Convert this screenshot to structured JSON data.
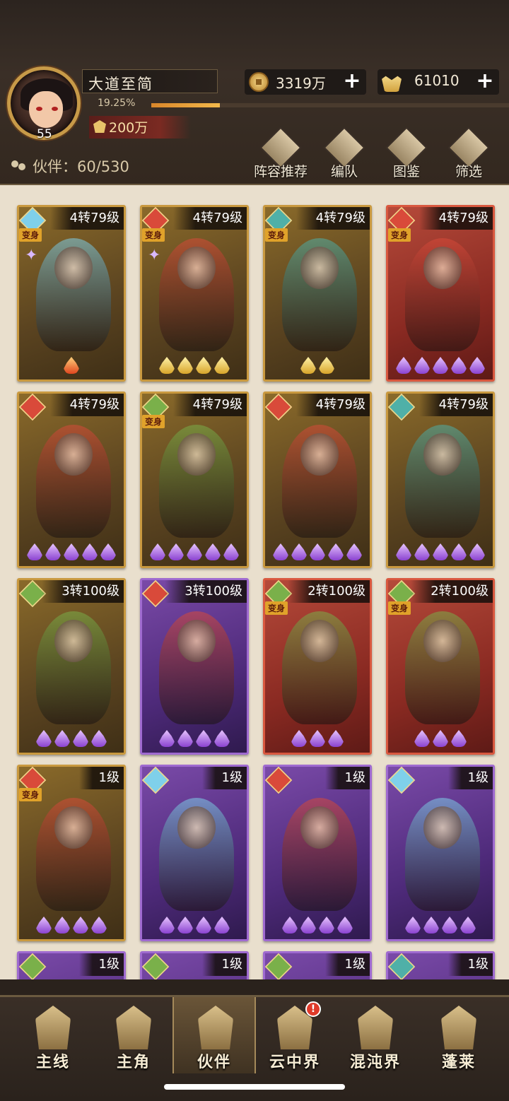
{
  "player": {
    "name": "大道至简",
    "level": "55",
    "exp_percent": "19.25%",
    "exp_fraction": 0.1925,
    "power": "200万"
  },
  "resources": {
    "coins": "3319万",
    "ingots": "61010"
  },
  "partner_count": "伙伴：60/530",
  "toolbar": [
    "阵容推荐",
    "编队",
    "图鉴",
    "筛选"
  ],
  "cards": [
    {
      "level": "4转79级",
      "frame": "gold",
      "element": "ice",
      "bian": true,
      "stars": 1,
      "star_color": "red",
      "sparkle": true
    },
    {
      "level": "4转79级",
      "frame": "gold",
      "element": "fire",
      "bian": true,
      "stars": 4,
      "star_color": "gold",
      "sparkle": true
    },
    {
      "level": "4转79级",
      "frame": "gold",
      "element": "ghost",
      "bian": true,
      "stars": 2,
      "star_color": "gold",
      "sparkle": false
    },
    {
      "level": "4转79级",
      "frame": "red",
      "element": "fire",
      "bian": true,
      "stars": 5,
      "star_color": "purple",
      "sparkle": false
    },
    {
      "level": "4转79级",
      "frame": "gold",
      "element": "fire",
      "bian": false,
      "stars": 5,
      "star_color": "purple",
      "sparkle": false
    },
    {
      "level": "4转79级",
      "frame": "gold",
      "element": "wind",
      "bian": true,
      "stars": 5,
      "star_color": "purple",
      "sparkle": false
    },
    {
      "level": "4转79级",
      "frame": "gold",
      "element": "fire",
      "bian": false,
      "stars": 5,
      "star_color": "purple",
      "sparkle": false
    },
    {
      "level": "4转79级",
      "frame": "gold",
      "element": "ghost",
      "bian": false,
      "stars": 5,
      "star_color": "purple",
      "sparkle": false
    },
    {
      "level": "3转100级",
      "frame": "gold",
      "element": "wind",
      "bian": false,
      "stars": 4,
      "star_color": "purple",
      "sparkle": false
    },
    {
      "level": "3转100级",
      "frame": "purple",
      "element": "fire",
      "bian": false,
      "stars": 4,
      "star_color": "purple",
      "sparkle": false
    },
    {
      "level": "2转100级",
      "frame": "red",
      "element": "wind",
      "bian": true,
      "stars": 3,
      "star_color": "purple",
      "sparkle": false
    },
    {
      "level": "2转100级",
      "frame": "red",
      "element": "wind",
      "bian": true,
      "stars": 3,
      "star_color": "purple",
      "sparkle": false
    },
    {
      "level": "1级",
      "frame": "gold",
      "element": "fire",
      "bian": true,
      "stars": 4,
      "star_color": "purple",
      "sparkle": false
    },
    {
      "level": "1级",
      "frame": "purple",
      "element": "ice",
      "bian": false,
      "stars": 4,
      "star_color": "purple",
      "sparkle": false
    },
    {
      "level": "1级",
      "frame": "purple",
      "element": "fire",
      "bian": false,
      "stars": 4,
      "star_color": "purple",
      "sparkle": false
    },
    {
      "level": "1级",
      "frame": "purple",
      "element": "ice",
      "bian": false,
      "stars": 4,
      "star_color": "purple",
      "sparkle": false
    },
    {
      "level": "1级",
      "frame": "purple",
      "element": "wind",
      "bian": false,
      "stars": 0,
      "star_color": "purple",
      "sparkle": false
    },
    {
      "level": "1级",
      "frame": "purple",
      "element": "wind",
      "bian": false,
      "stars": 0,
      "star_color": "purple",
      "sparkle": false
    },
    {
      "level": "1级",
      "frame": "purple",
      "element": "wind",
      "bian": false,
      "stars": 0,
      "star_color": "purple",
      "sparkle": false
    },
    {
      "level": "1级",
      "frame": "purple",
      "element": "ghost",
      "bian": false,
      "stars": 0,
      "star_color": "purple",
      "sparkle": false
    }
  ],
  "bian_label": "变身",
  "nav": [
    {
      "label": "主线",
      "active": false,
      "notify": false
    },
    {
      "label": "主角",
      "active": false,
      "notify": false
    },
    {
      "label": "伙伴",
      "active": true,
      "notify": false
    },
    {
      "label": "云中界",
      "active": false,
      "notify": true
    },
    {
      "label": "混沌界",
      "active": false,
      "notify": false
    },
    {
      "label": "蓬莱",
      "active": false,
      "notify": false
    }
  ],
  "notify_mark": "!",
  "colors": {
    "ice": "#7fd0ea",
    "fire": "#d94a3a",
    "ghost": "#4fb0a8",
    "wind": "#7ab04a"
  }
}
